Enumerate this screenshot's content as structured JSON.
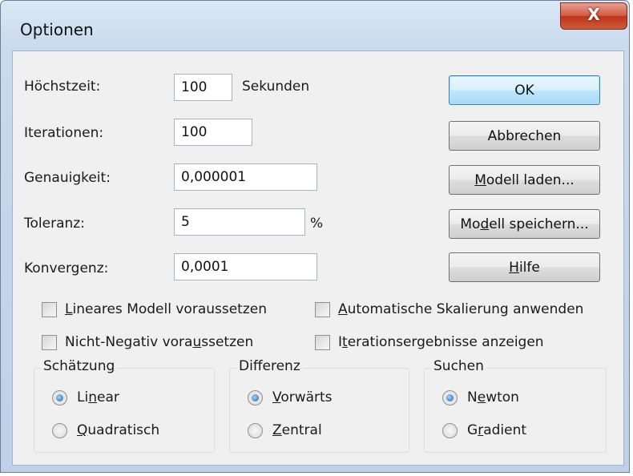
{
  "window": {
    "title": "Optionen",
    "close_glyph": "X"
  },
  "fields": {
    "hoechstzeit": {
      "label": "Höchstzeit:",
      "value": "100",
      "unit": "Sekunden"
    },
    "iterationen": {
      "label": "Iterationen:",
      "value": "100"
    },
    "genauigkeit": {
      "label": "Genauigkeit:",
      "value": "0,000001"
    },
    "toleranz": {
      "label": "Toleranz:",
      "value": "5",
      "unit": "%"
    },
    "konvergenz": {
      "label": "Konvergenz:",
      "value": "0,0001"
    }
  },
  "buttons": {
    "ok": "OK",
    "abbrechen": "Abbrechen",
    "modell_laden": {
      "pre": "",
      "key": "M",
      "post": "odell laden..."
    },
    "modell_speichern": {
      "pre": "Mo",
      "key": "d",
      "post": "ell speichern..."
    },
    "hilfe": {
      "pre": "",
      "key": "H",
      "post": "ilfe"
    }
  },
  "checkboxes": {
    "lineares_modell": {
      "pre": "",
      "key": "L",
      "post": "ineares Modell voraussetzen",
      "checked": false
    },
    "automatische_skalierung": {
      "pre": "",
      "key": "A",
      "post": "utomatische Skalierung anwenden",
      "checked": false
    },
    "nicht_negativ": {
      "pre": "Nicht-Negativ vora",
      "key": "u",
      "post": "ssetzen",
      "checked": false
    },
    "iterationsergebnisse": {
      "pre": "I",
      "key": "t",
      "post": "erationsergebnisse anzeigen",
      "checked": false
    }
  },
  "groups": {
    "schaetzung": {
      "title": "Schätzung",
      "options": [
        {
          "pre": "Li",
          "key": "n",
          "post": "ear",
          "selected": true
        },
        {
          "pre": "",
          "key": "Q",
          "post": "uadratisch",
          "selected": false
        }
      ]
    },
    "differenz": {
      "title": "Differenz",
      "options": [
        {
          "pre": "",
          "key": "V",
          "post": "orwärts",
          "selected": true
        },
        {
          "pre": "",
          "key": "Z",
          "post": "entral",
          "selected": false
        }
      ]
    },
    "suchen": {
      "title": "Suchen",
      "options": [
        {
          "pre": "N",
          "key": "e",
          "post": "wton",
          "selected": true
        },
        {
          "pre": "G",
          "key": "r",
          "post": "adient",
          "selected": false
        }
      ]
    }
  }
}
